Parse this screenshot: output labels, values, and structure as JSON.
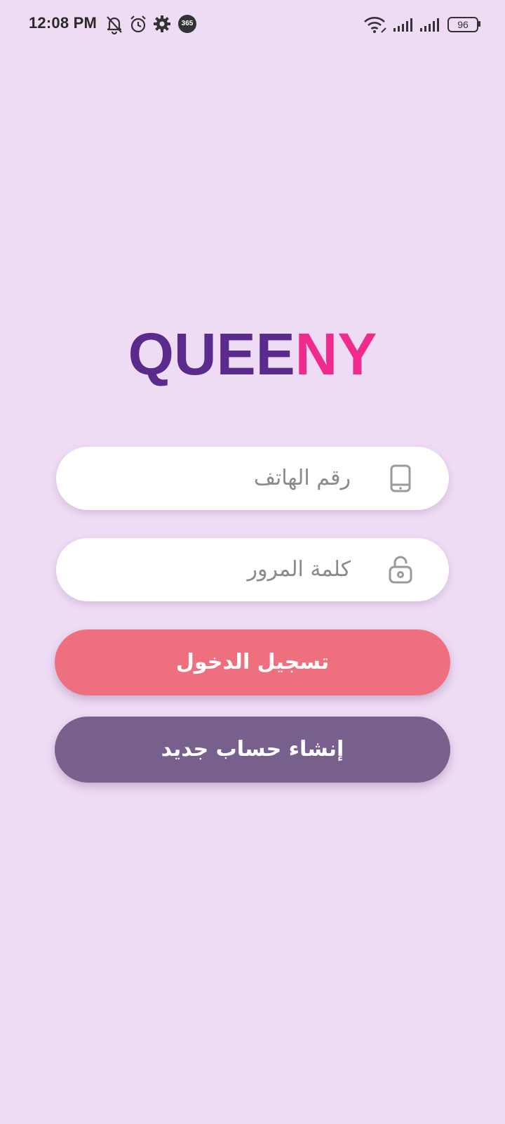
{
  "status_bar": {
    "time": "12:08 PM",
    "battery": "96",
    "notification_icons": [
      "bell-off-icon",
      "alarm-icon",
      "settings-gear-icon",
      "app-365-icon"
    ],
    "app_badge": "365"
  },
  "logo": {
    "part1": "QUEE",
    "part2": "NY",
    "color_part1": "#5a2a8c",
    "color_part2": "#f02b8e"
  },
  "form": {
    "phone_placeholder": "رقم الهاتف",
    "phone_icon": "phone-icon",
    "password_placeholder": "كلمة المرور",
    "password_icon": "unlock-icon",
    "login_label": "تسجيل الدخول",
    "register_label": "إنشاء حساب جديد"
  },
  "colors": {
    "background": "#eedbf4",
    "login_button": "#ee707f",
    "register_button": "#77608c"
  }
}
